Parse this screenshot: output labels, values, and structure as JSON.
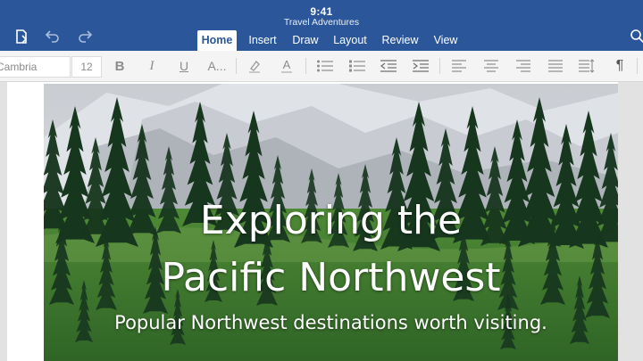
{
  "status": {
    "time": "9:41"
  },
  "document": {
    "title": "Travel Adventures"
  },
  "toolbar": {
    "icons": [
      "document-menu-icon",
      "undo-icon",
      "redo-icon",
      "search-icon"
    ]
  },
  "tabs": [
    {
      "label": "Home",
      "active": true
    },
    {
      "label": "Insert",
      "active": false
    },
    {
      "label": "Draw",
      "active": false
    },
    {
      "label": "Layout",
      "active": false
    },
    {
      "label": "Review",
      "active": false
    },
    {
      "label": "View",
      "active": false
    }
  ],
  "ribbon": {
    "font_name": "Cambria",
    "font_size": "12",
    "bold": "B",
    "italic": "I",
    "underline": "U",
    "more_text": "A...",
    "font_color": "A",
    "paragraph_mark": "¶"
  },
  "hero": {
    "title_line1": "Exploring the",
    "title_line2": "Pacific Northwest",
    "subtitle": "Popular Northwest destinations worth visiting."
  },
  "colors": {
    "brand": "#2b579a",
    "ribbon_bg": "#f4f4f4",
    "forest": "#1f4a2a",
    "meadow": "#3f7f2e"
  }
}
